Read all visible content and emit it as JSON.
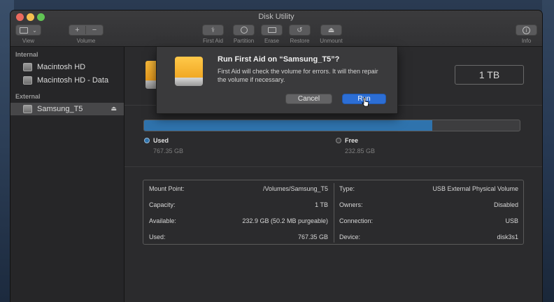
{
  "window": {
    "title": "Disk Utility"
  },
  "toolbar": {
    "view_label": "View",
    "volume_label": "Volume",
    "first_aid_label": "First Aid",
    "partition_label": "Partition",
    "erase_label": "Erase",
    "restore_label": "Restore",
    "unmount_label": "Unmount",
    "info_label": "Info"
  },
  "sidebar": {
    "internal_header": "Internal",
    "external_header": "External",
    "internal_items": [
      {
        "label": "Macintosh HD"
      },
      {
        "label": "Macintosh HD - Data"
      }
    ],
    "external_items": [
      {
        "label": "Samsung_T5",
        "selected": true
      }
    ]
  },
  "main": {
    "capacity": "1 TB",
    "usage": {
      "used_fraction": 0.767,
      "used_label": "Used",
      "used_value": "767.35 GB",
      "free_label": "Free",
      "free_value": "232.85 GB",
      "used_color": "#2f73ad"
    },
    "info": {
      "left": [
        {
          "key": "Mount Point:",
          "value": "/Volumes/Samsung_T5"
        },
        {
          "key": "Capacity:",
          "value": "1 TB"
        },
        {
          "key": "Available:",
          "value": "232.9 GB (50.2 MB purgeable)"
        },
        {
          "key": "Used:",
          "value": "767.35 GB"
        }
      ],
      "right": [
        {
          "key": "Type:",
          "value": "USB External Physical Volume"
        },
        {
          "key": "Owners:",
          "value": "Disabled"
        },
        {
          "key": "Connection:",
          "value": "USB"
        },
        {
          "key": "Device:",
          "value": "disk3s1"
        }
      ]
    }
  },
  "dialog": {
    "title": "Run First Aid on “Samsung_T5”?",
    "message": "First Aid will check the volume for errors. It will then repair the volume if necessary.",
    "cancel_label": "Cancel",
    "run_label": "Run",
    "accent": "#2c6ed5"
  }
}
